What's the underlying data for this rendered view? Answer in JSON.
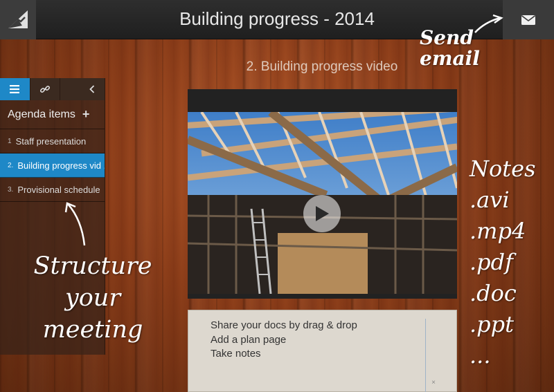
{
  "header": {
    "title": "Building progress - 2014",
    "logo_icon": "handshake-logo-icon",
    "mail_icon": "envelope-icon"
  },
  "subtitle": "2. Building progress video",
  "sidebar": {
    "tabs": [
      {
        "icon": "list-icon",
        "active": true
      },
      {
        "icon": "link-icon",
        "active": false
      },
      {
        "icon": "chevron-left-icon",
        "active": false
      }
    ],
    "heading": "Agenda items",
    "add_symbol": "+",
    "items": [
      {
        "num": "1",
        "label": "Staff presentation",
        "active": false
      },
      {
        "num": "2.",
        "label": "Building progress vid ...",
        "active": true
      },
      {
        "num": "3.",
        "label": "Provisional schedule",
        "active": false
      }
    ],
    "accent_color": "#1e88c7"
  },
  "video": {
    "play_icon": "play-icon"
  },
  "notes": {
    "lines": [
      "Share your docs by drag & drop",
      "Add a plan page",
      "Take notes"
    ],
    "close_symbol": "×"
  },
  "annotations": {
    "send_email": [
      "Send",
      "email"
    ],
    "structure": [
      "Structure",
      "your",
      "meeting"
    ],
    "notes_list": [
      "Notes",
      ".avi",
      ".mp4",
      ".pdf",
      ".doc",
      ".ppt",
      "..."
    ]
  }
}
